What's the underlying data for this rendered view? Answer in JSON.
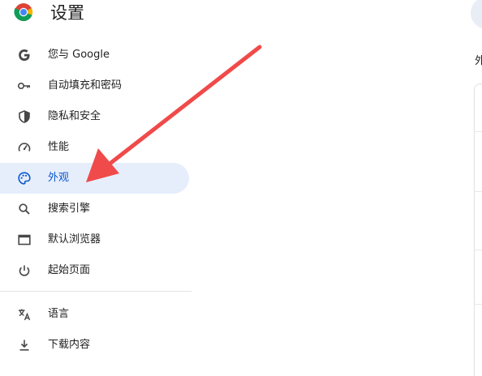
{
  "header": {
    "title": "设置",
    "logo_icon": "chrome-logo",
    "search_icon": "search-icon"
  },
  "sidebar": {
    "items": [
      {
        "label": "您与 Google",
        "icon": "google-icon"
      },
      {
        "label": "自动填充和密码",
        "icon": "key-icon"
      },
      {
        "label": "隐私和安全",
        "icon": "shield-icon"
      },
      {
        "label": "性能",
        "icon": "speedometer-icon"
      },
      {
        "label": "外观",
        "icon": "palette-icon",
        "active": true
      },
      {
        "label": "搜索引擎",
        "icon": "search-icon"
      },
      {
        "label": "默认浏览器",
        "icon": "browser-window-icon"
      },
      {
        "label": "起始页面",
        "icon": "power-icon"
      },
      {
        "label": "语言",
        "icon": "translate-icon"
      },
      {
        "label": "下载内容",
        "icon": "download-icon"
      }
    ]
  },
  "main": {
    "section_heading": "外"
  },
  "annotation": {
    "arrow_color": "#f04a4a",
    "arrow_icon": "red-arrow-annotation"
  },
  "colors": {
    "active_bg": "#e6eefb",
    "active_text": "#0b57d0",
    "icon": "#474747"
  }
}
